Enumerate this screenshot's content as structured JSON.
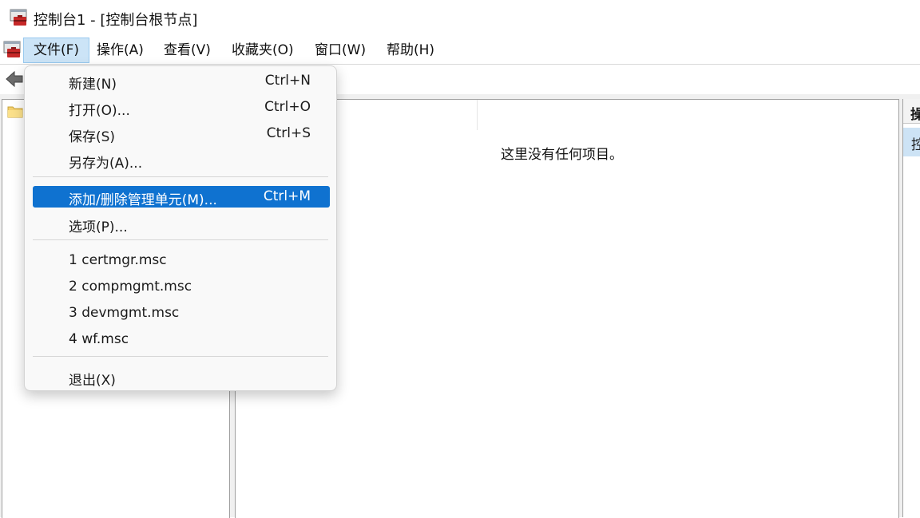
{
  "window": {
    "title": "控制台1 - [控制台根节点]"
  },
  "menubar": {
    "items": [
      {
        "label": "文件(F)",
        "active": true
      },
      {
        "label": "操作(A)"
      },
      {
        "label": "查看(V)"
      },
      {
        "label": "收藏夹(O)"
      },
      {
        "label": "窗口(W)"
      },
      {
        "label": "帮助(H)"
      }
    ]
  },
  "file_menu": {
    "items": [
      {
        "label": "新建(N)",
        "shortcut": "Ctrl+N"
      },
      {
        "label": "打开(O)...",
        "shortcut": "Ctrl+O"
      },
      {
        "label": "保存(S)",
        "shortcut": "Ctrl+S"
      },
      {
        "label": "另存为(A)...",
        "shortcut": ""
      },
      {
        "label": "添加/删除管理单元(M)...",
        "shortcut": "Ctrl+M",
        "highlighted": true
      },
      {
        "label": "选项(P)...",
        "shortcut": ""
      },
      {
        "label": "1 certmgr.msc",
        "shortcut": ""
      },
      {
        "label": "2 compmgmt.msc",
        "shortcut": ""
      },
      {
        "label": "3 devmgmt.msc",
        "shortcut": ""
      },
      {
        "label": "4 wf.msc",
        "shortcut": ""
      },
      {
        "label": "退出(X)",
        "shortcut": ""
      }
    ]
  },
  "result_pane": {
    "empty_text": "这里没有任何项目。"
  },
  "action_pane": {
    "header": "操",
    "selected": "控"
  },
  "colors": {
    "highlight": "#0f72d0",
    "menu_active_bg": "#cce4f7",
    "selection_bg": "#cde3f5"
  },
  "icons": {
    "app": "mmc-icon",
    "back": "back-arrow-icon",
    "folder": "folder-icon"
  }
}
